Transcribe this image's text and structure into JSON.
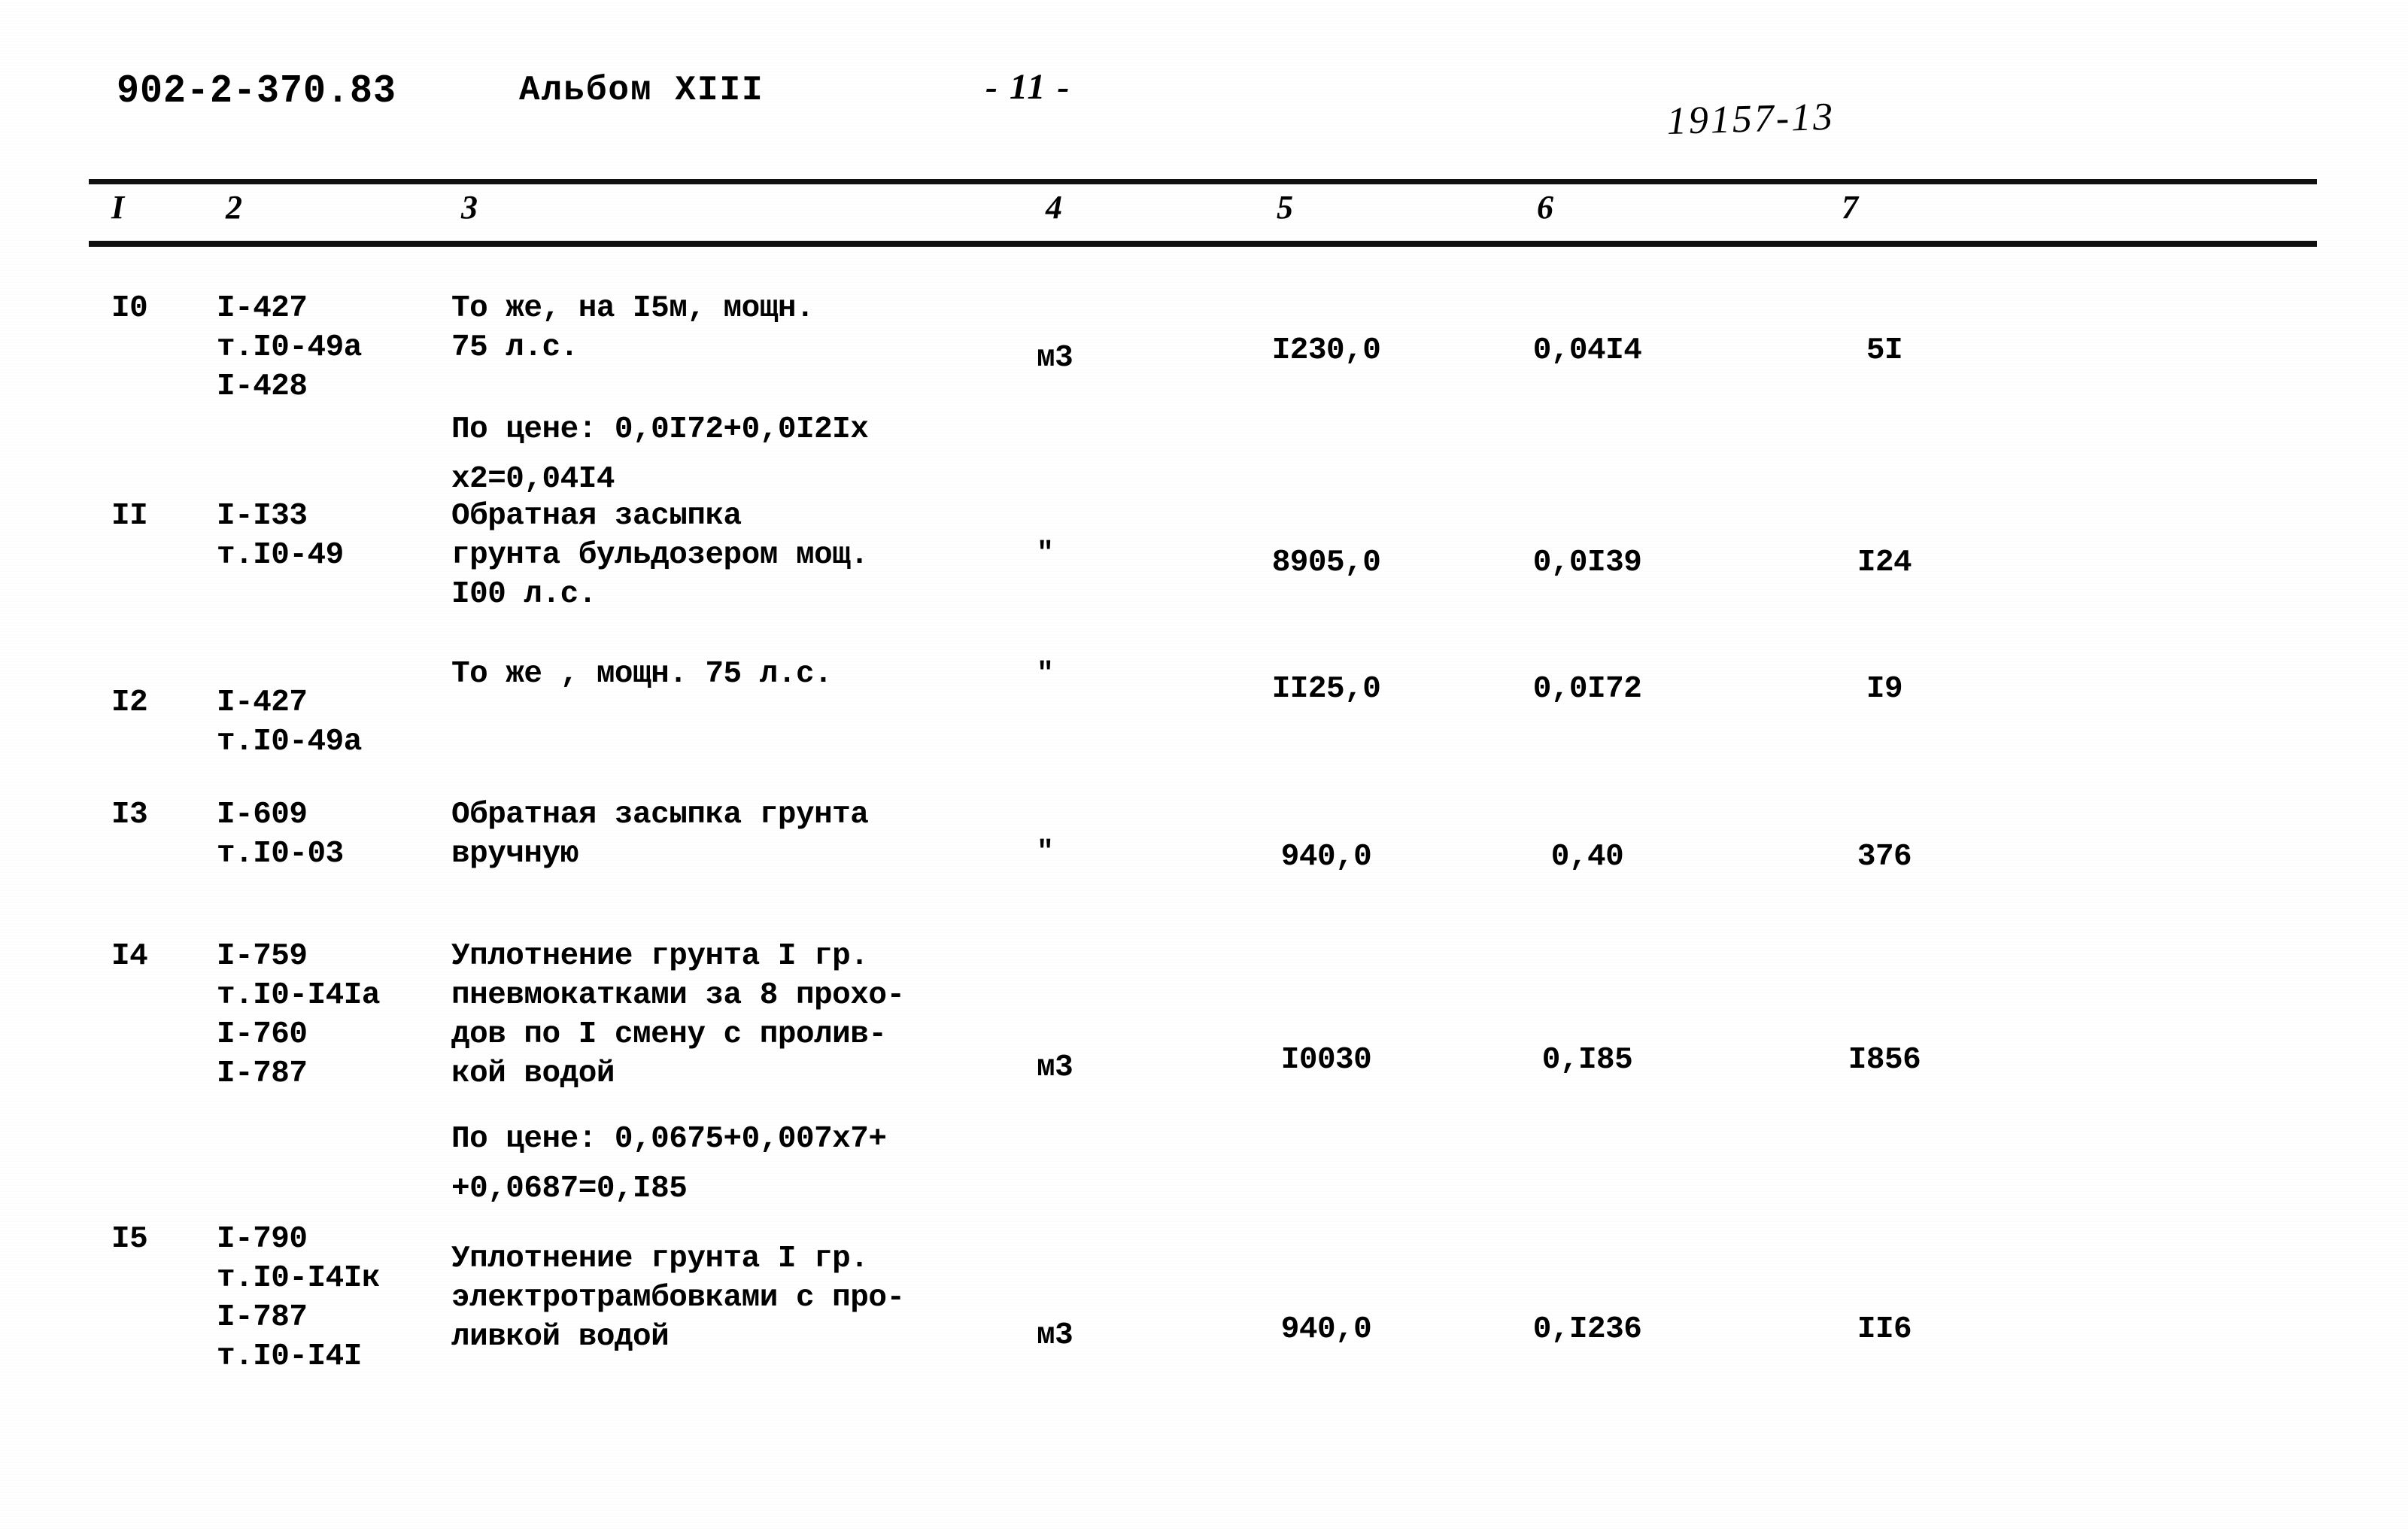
{
  "header": {
    "doc_code": "902-2-370.83",
    "album_label": "Альбом XIII",
    "page_number": "- 11 -",
    "stamp_number": "19157-13"
  },
  "table": {
    "column_headers": [
      "I",
      "2",
      "3",
      "4",
      "5",
      "6",
      "7"
    ],
    "rows": [
      {
        "num": "I0",
        "code": "I-427\nт.I0-49а\nI-428",
        "description": "То же, на I5м, мощн.\n75 л.с.",
        "formula": "По цене: 0,0I72+0,0I2Iх\nх2=0,04I4",
        "unit": "м3",
        "quantity": "I230,0",
        "price": "0,04I4",
        "total": "5I"
      },
      {
        "num": "II",
        "code": "I-I33\nт.I0-49",
        "description": "Обратная засыпка\nгрунта бульдозером мощ.\nI00 л.с.",
        "formula": "",
        "unit": "\"",
        "quantity": "8905,0",
        "price": "0,0I39",
        "total": "I24"
      },
      {
        "num": "I2",
        "code": "I-427\nт.I0-49а",
        "description": "То же , мощн. 75 л.с.",
        "formula": "",
        "unit": "\"",
        "quantity": "II25,0",
        "price": "0,0I72",
        "total": "I9"
      },
      {
        "num": "I3",
        "code": "I-609\nт.I0-03",
        "description": "Обратная засыпка грунта\nвручную",
        "formula": "",
        "unit": "\"",
        "quantity": "940,0",
        "price": "0,40",
        "total": "376"
      },
      {
        "num": "I4",
        "code": "I-759\nт.I0-I4Iа\nI-760\nI-787",
        "description": "Уплотнение грунта I гр.\nпневмокатками за 8 прохо-\nдов по I смену с пролив-\nкой водой",
        "formula": "По цене: 0,0675+0,007х7+\n+0,0687=0,I85",
        "unit": "м3",
        "quantity": "I0030",
        "price": "0,I85",
        "total": "I856"
      },
      {
        "num": "I5",
        "code": "I-790\nт.I0-I4Iк\nI-787\nт.I0-I4I",
        "description": "Уплотнение грунта I гр.\nэлектротрамбовками с про-\nливкой водой",
        "formula": "",
        "unit": "м3",
        "quantity": "940,0",
        "price": "0,I236",
        "total": "II6"
      }
    ]
  }
}
